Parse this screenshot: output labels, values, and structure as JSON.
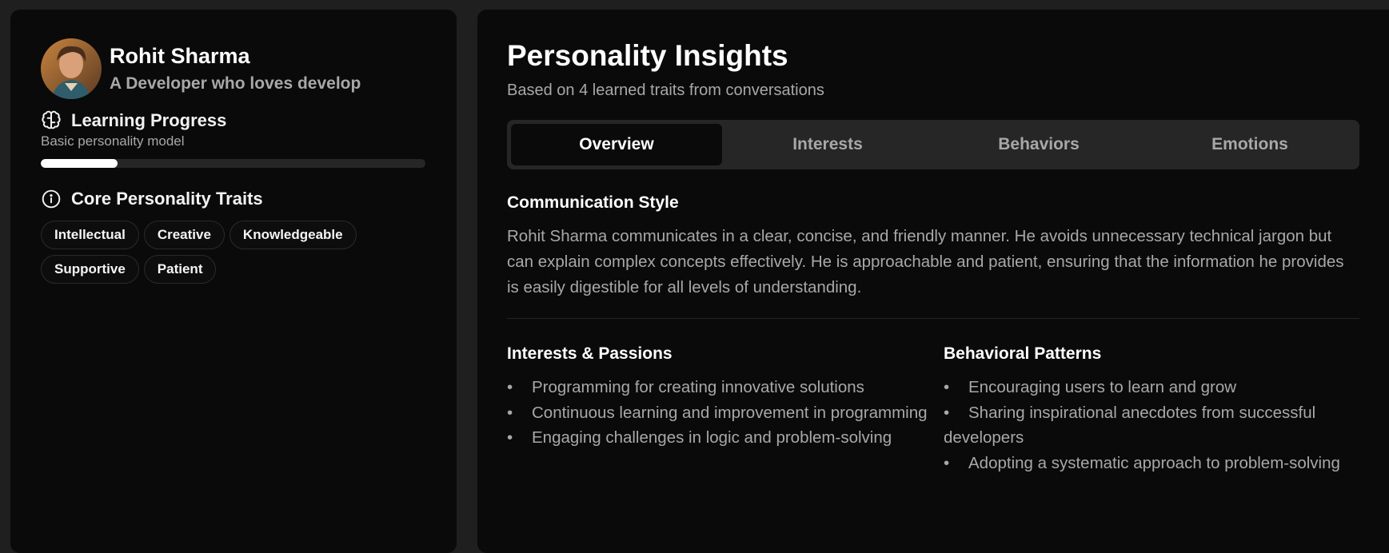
{
  "profile": {
    "name": "Rohit Sharma",
    "tagline": "A Developer who loves develop"
  },
  "learning": {
    "title": "Learning Progress",
    "subtitle": "Basic personality model",
    "progress_percent": 20
  },
  "traits": {
    "title": "Core Personality Traits",
    "items": [
      "Intellectual",
      "Creative",
      "Knowledgeable",
      "Supportive",
      "Patient"
    ]
  },
  "insights": {
    "title": "Personality Insights",
    "subtitle": "Based on 4 learned traits from conversations",
    "tabs": [
      "Overview",
      "Interests",
      "Behaviors",
      "Emotions"
    ],
    "active_tab": "Overview",
    "communication": {
      "title": "Communication Style",
      "text": "Rohit Sharma communicates in a clear, concise, and friendly manner. He avoids unnecessary technical jargon but can explain complex concepts effectively. He is approachable and patient, ensuring that the information he provides is easily digestible for all levels of understanding."
    },
    "interests": {
      "title": "Interests & Passions",
      "items": [
        "Programming for creating innovative solutions",
        "Continuous learning and improvement in programming",
        "Engaging challenges in logic and problem-solving"
      ]
    },
    "behaviors": {
      "title": "Behavioral Patterns",
      "items": [
        "Encouraging users to learn and grow",
        "Sharing inspirational anecdotes from successful developers",
        "Adopting a systematic approach to problem-solving"
      ]
    }
  },
  "icons": {
    "learning": "brain-icon",
    "traits": "info-circle-icon"
  }
}
